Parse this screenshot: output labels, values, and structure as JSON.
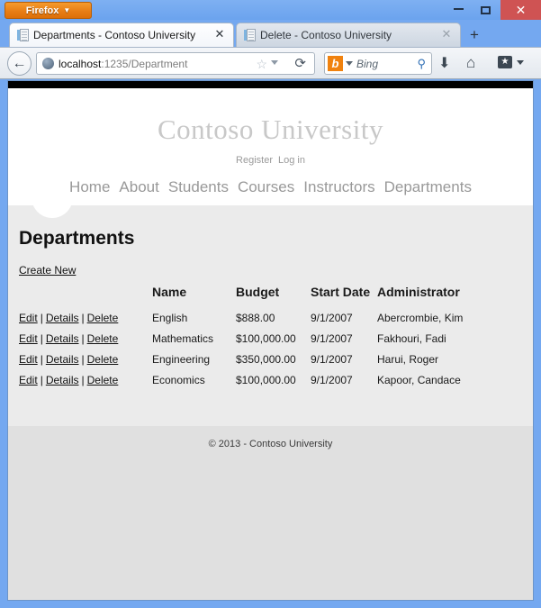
{
  "browser": {
    "app_button": "Firefox",
    "window_controls": {
      "minimize": "–",
      "maximize": "□",
      "close": "✕"
    },
    "tabs": [
      {
        "title": "Departments - Contoso University",
        "active": true,
        "close": "✕"
      },
      {
        "title": "Delete - Contoso University",
        "active": false,
        "close": "✕"
      }
    ],
    "new_tab": "+",
    "back": "←",
    "url": {
      "host": "localhost",
      "rest": ":1235/Department"
    },
    "star": "☆",
    "reload": "⟳",
    "search": {
      "engine": "b",
      "placeholder": "Bing",
      "go": "🔍"
    },
    "download": "⬇",
    "home": "⌂",
    "bookmarks": "★"
  },
  "site": {
    "brand": "Contoso University",
    "account_links": [
      {
        "label": "Register"
      },
      {
        "label": "Log in"
      }
    ],
    "nav": [
      {
        "label": "Home"
      },
      {
        "label": "About"
      },
      {
        "label": "Students"
      },
      {
        "label": "Courses"
      },
      {
        "label": "Instructors"
      },
      {
        "label": "Departments"
      }
    ],
    "footer": "© 2013 - Contoso University"
  },
  "page": {
    "title": "Departments",
    "create_new": "Create New",
    "table": {
      "headers": {
        "actions": "",
        "name": "Name",
        "budget": "Budget",
        "start_date": "Start Date",
        "administrator": "Administrator"
      },
      "actions": {
        "edit": "Edit",
        "details": "Details",
        "delete": "Delete",
        "separator": "|"
      },
      "rows": [
        {
          "name": "English",
          "budget": "$888.00",
          "start_date": "9/1/2007",
          "administrator": "Abercrombie, Kim"
        },
        {
          "name": "Mathematics",
          "budget": "$100,000.00",
          "start_date": "9/1/2007",
          "administrator": "Fakhouri, Fadi"
        },
        {
          "name": "Engineering",
          "budget": "$350,000.00",
          "start_date": "9/1/2007",
          "administrator": "Harui, Roger"
        },
        {
          "name": "Economics",
          "budget": "$100,000.00",
          "start_date": "9/1/2007",
          "administrator": "Kapoor, Candace"
        }
      ]
    }
  },
  "colors": {
    "window_frame": "#74a8f0",
    "firefox_orange": "#e87e16",
    "close_red": "#cf5353",
    "page_bg": "#ebebeb",
    "footer_bg": "#e0e0e0",
    "brand_gray": "#c8c8c8",
    "nav_gray": "#999999"
  }
}
